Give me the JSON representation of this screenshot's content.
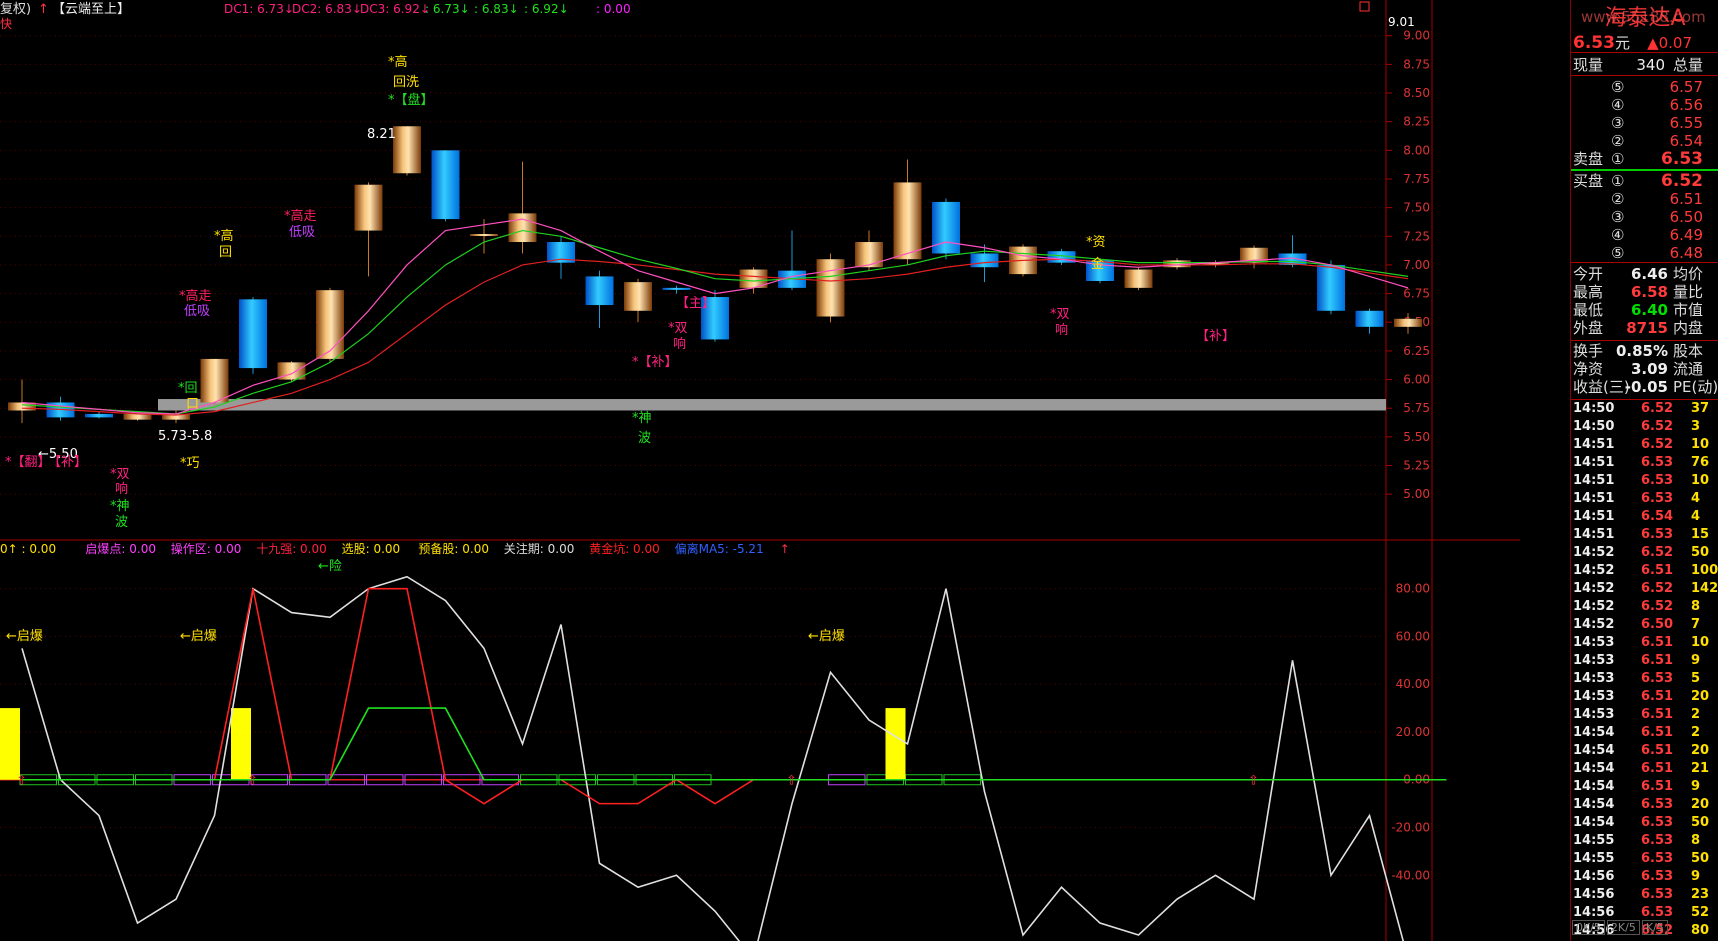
{
  "header": {
    "left_text": "复权)",
    "indicator_name": "【云端至上】",
    "dc1": "DC1: 6.73",
    "dc2": "DC2: 6.83",
    "dc3": "DC3: 6.92",
    "v1": ": 6.73",
    "v2": ": 6.83",
    "v3": ": 6.92",
    "v4": ": 0.00",
    "corner_mark": "快",
    "top_right_price": "9.01"
  },
  "price_axis": [
    "9.00",
    "8.75",
    "8.50",
    "8.25",
    "8.00",
    "7.75",
    "7.50",
    "7.25",
    "7.00",
    "6.75",
    "6.50",
    "6.25",
    "6.00",
    "5.75",
    "5.50",
    "5.25",
    "5.00"
  ],
  "osc_axis": [
    "80.00",
    "60.00",
    "40.00",
    "20.00",
    "0.00",
    "-20.00",
    "-40.00"
  ],
  "osc_header": {
    "i0": "0↑ : 0.00",
    "qibao": "启爆点: 0.00",
    "caozuo": "操作区: 0.00",
    "shijiu": "十九强: 0.00",
    "xuangu": "选股: 0.00",
    "yubei": "预备股: 0.00",
    "guanzhu": "关注期: 0.00",
    "huangjin": "黄金坑: 0.00",
    "pianli": "偏离MA5: -5.21"
  },
  "annotations": {
    "gao1": "*高",
    "huixi": "回洗",
    "pan": "*【盘】",
    "gao2": "*高",
    "hui2": "回",
    "gaozou1": "*高走",
    "dixi1": "低吸",
    "gaozou2": "*高走",
    "dixi2": "低吸",
    "price821": "8.21",
    "hui3": "*回",
    "kou": "口",
    "range": "5.73-5.8",
    "p550": "←5.50",
    "fan": "*【翻】",
    "bu1": "【补】",
    "shuang1": "*双",
    "xiang1": "响",
    "shen1": "*神",
    "bo1": "波",
    "qiao": "*巧",
    "shen2": "*神",
    "bo2": "波",
    "zhu1": "【主】",
    "shuang2": "*双",
    "xiang2": "响",
    "bu2": "*【补】",
    "zi": "*资",
    "jin": "金",
    "shuang3": "*双",
    "xiang3": "响",
    "bu3": "【补】",
    "qibao1": "←启爆",
    "qibao2": "←启爆",
    "qibao3": "←启爆",
    "xian": "←险"
  },
  "quote": {
    "name": "海泰达A",
    "watermark": "www.55188.com",
    "price": "6.53",
    "unit": "元",
    "change": "▲0.07",
    "xianliang_label": "现量",
    "xianliang": "340",
    "zongliang_label": "总量",
    "sell": [
      {
        "n": "⑤",
        "p": "6.57"
      },
      {
        "n": "④",
        "p": "6.56"
      },
      {
        "n": "③",
        "p": "6.55"
      },
      {
        "n": "②",
        "p": "6.54"
      },
      {
        "n": "①",
        "p": "6.53",
        "label": "卖盘"
      }
    ],
    "buy": [
      {
        "n": "①",
        "p": "6.52",
        "label": "买盘"
      },
      {
        "n": "②",
        "p": "6.51"
      },
      {
        "n": "③",
        "p": "6.50"
      },
      {
        "n": "④",
        "p": "6.49"
      },
      {
        "n": "⑤",
        "p": "6.48"
      }
    ],
    "stats": [
      {
        "l": "今开",
        "v": "6.46",
        "l2": "均价",
        "c": "white"
      },
      {
        "l": "最高",
        "v": "6.58",
        "l2": "量比",
        "c": "red"
      },
      {
        "l": "最低",
        "v": "6.40",
        "l2": "市值",
        "c": "green"
      },
      {
        "l": "外盘",
        "v": "8715",
        "l2": "内盘",
        "c": "red"
      }
    ],
    "stats2": [
      {
        "l": "换手",
        "v": "0.85%",
        "l2": "股本"
      },
      {
        "l": "净资",
        "v": "3.09",
        "l2": "流通"
      },
      {
        "l": "收益(三)",
        "v": "-0.05",
        "l2": "PE(动)"
      }
    ],
    "ticks": [
      {
        "t": "14:50",
        "p": "6.52",
        "v": "37",
        "c": "red"
      },
      {
        "t": "14:50",
        "p": "6.52",
        "v": "3",
        "c": "red"
      },
      {
        "t": "14:51",
        "p": "6.52",
        "v": "10",
        "c": "red"
      },
      {
        "t": "14:51",
        "p": "6.53",
        "v": "76",
        "c": "red"
      },
      {
        "t": "14:51",
        "p": "6.53",
        "v": "10",
        "c": "red"
      },
      {
        "t": "14:51",
        "p": "6.53",
        "v": "4",
        "c": "red"
      },
      {
        "t": "14:51",
        "p": "6.54",
        "v": "4",
        "c": "red"
      },
      {
        "t": "14:51",
        "p": "6.53",
        "v": "15",
        "c": "red"
      },
      {
        "t": "14:52",
        "p": "6.52",
        "v": "50",
        "c": "red"
      },
      {
        "t": "14:52",
        "p": "6.51",
        "v": "100",
        "c": "red"
      },
      {
        "t": "14:52",
        "p": "6.52",
        "v": "142",
        "c": "red"
      },
      {
        "t": "14:52",
        "p": "6.52",
        "v": "8",
        "c": "red"
      },
      {
        "t": "14:52",
        "p": "6.50",
        "v": "7",
        "c": "red"
      },
      {
        "t": "14:53",
        "p": "6.51",
        "v": "10",
        "c": "red"
      },
      {
        "t": "14:53",
        "p": "6.51",
        "v": "9",
        "c": "red"
      },
      {
        "t": "14:53",
        "p": "6.53",
        "v": "5",
        "c": "red"
      },
      {
        "t": "14:53",
        "p": "6.51",
        "v": "20",
        "c": "red"
      },
      {
        "t": "14:53",
        "p": "6.51",
        "v": "2",
        "c": "red"
      },
      {
        "t": "14:54",
        "p": "6.51",
        "v": "2",
        "c": "red"
      },
      {
        "t": "14:54",
        "p": "6.51",
        "v": "20",
        "c": "red"
      },
      {
        "t": "14:54",
        "p": "6.51",
        "v": "21",
        "c": "red"
      },
      {
        "t": "14:54",
        "p": "6.51",
        "v": "9",
        "c": "red"
      },
      {
        "t": "14:54",
        "p": "6.53",
        "v": "20",
        "c": "red"
      },
      {
        "t": "14:54",
        "p": "6.53",
        "v": "50",
        "c": "red"
      },
      {
        "t": "14:55",
        "p": "6.53",
        "v": "8",
        "c": "red"
      },
      {
        "t": "14:55",
        "p": "6.53",
        "v": "50",
        "c": "red"
      },
      {
        "t": "14:56",
        "p": "6.53",
        "v": "9",
        "c": "red"
      },
      {
        "t": "14:56",
        "p": "6.53",
        "v": "23",
        "c": "red"
      },
      {
        "t": "14:56",
        "p": "6.53",
        "v": "52",
        "c": "red"
      },
      {
        "t": "14:56",
        "p": "6.52",
        "v": "80",
        "c": "red"
      }
    ],
    "tabs": [
      "0K/5",
      "2K/5",
      "K/5"
    ]
  },
  "chart_data": {
    "type": "candlestick",
    "y_range": [
      4.6,
      9.05
    ],
    "support_band": [
      5.73,
      5.83
    ],
    "candles": [
      {
        "o": 5.73,
        "c": 5.8,
        "h": 6.0,
        "l": 5.62,
        "col": "gold"
      },
      {
        "o": 5.8,
        "c": 5.67,
        "h": 5.85,
        "l": 5.64,
        "col": "blue"
      },
      {
        "o": 5.7,
        "c": 5.67,
        "h": 5.72,
        "l": 5.66,
        "col": "blue"
      },
      {
        "o": 5.65,
        "c": 5.7,
        "h": 5.72,
        "l": 5.64,
        "col": "gold"
      },
      {
        "o": 5.65,
        "c": 5.7,
        "h": 5.73,
        "l": 5.62,
        "col": "gold"
      },
      {
        "o": 5.8,
        "c": 6.18,
        "h": 6.18,
        "l": 5.78,
        "col": "gold"
      },
      {
        "o": 6.7,
        "c": 6.1,
        "h": 6.72,
        "l": 6.05,
        "col": "blue"
      },
      {
        "o": 6.0,
        "c": 6.15,
        "h": 6.16,
        "l": 5.98,
        "col": "gold"
      },
      {
        "o": 6.18,
        "c": 6.78,
        "h": 6.8,
        "l": 6.15,
        "col": "gold"
      },
      {
        "o": 7.3,
        "c": 7.7,
        "h": 7.72,
        "l": 6.9,
        "col": "gold"
      },
      {
        "o": 7.8,
        "c": 8.21,
        "h": 8.21,
        "l": 7.78,
        "col": "gold"
      },
      {
        "o": 8.0,
        "c": 7.4,
        "h": 8.0,
        "l": 7.38,
        "col": "blue"
      },
      {
        "o": 7.27,
        "c": 7.26,
        "h": 7.4,
        "l": 7.1,
        "col": "gold"
      },
      {
        "o": 7.2,
        "c": 7.45,
        "h": 7.9,
        "l": 7.1,
        "col": "gold"
      },
      {
        "o": 7.2,
        "c": 7.02,
        "h": 7.25,
        "l": 6.88,
        "col": "blue"
      },
      {
        "o": 6.9,
        "c": 6.65,
        "h": 6.95,
        "l": 6.45,
        "col": "blue"
      },
      {
        "o": 6.6,
        "c": 6.85,
        "h": 6.88,
        "l": 6.5,
        "col": "gold"
      },
      {
        "o": 6.8,
        "c": 6.79,
        "h": 6.82,
        "l": 6.75,
        "col": "blue"
      },
      {
        "o": 6.72,
        "c": 6.35,
        "h": 6.78,
        "l": 6.33,
        "col": "blue"
      },
      {
        "o": 6.8,
        "c": 6.96,
        "h": 6.98,
        "l": 6.75,
        "col": "gold"
      },
      {
        "o": 6.95,
        "c": 6.8,
        "h": 7.3,
        "l": 6.78,
        "col": "blue"
      },
      {
        "o": 6.55,
        "c": 7.05,
        "h": 7.1,
        "l": 6.5,
        "col": "gold"
      },
      {
        "o": 6.98,
        "c": 7.2,
        "h": 7.3,
        "l": 6.95,
        "col": "gold"
      },
      {
        "o": 7.05,
        "c": 7.72,
        "h": 7.92,
        "l": 7.0,
        "col": "gold"
      },
      {
        "o": 7.55,
        "c": 7.1,
        "h": 7.58,
        "l": 7.05,
        "col": "blue"
      },
      {
        "o": 7.1,
        "c": 6.98,
        "h": 7.18,
        "l": 6.85,
        "col": "blue"
      },
      {
        "o": 6.92,
        "c": 7.16,
        "h": 7.18,
        "l": 6.9,
        "col": "gold"
      },
      {
        "o": 7.12,
        "c": 7.02,
        "h": 7.14,
        "l": 7.0,
        "col": "blue"
      },
      {
        "o": 7.04,
        "c": 6.86,
        "h": 7.06,
        "l": 6.84,
        "col": "blue"
      },
      {
        "o": 6.8,
        "c": 6.96,
        "h": 6.98,
        "l": 6.78,
        "col": "gold"
      },
      {
        "o": 6.98,
        "c": 7.04,
        "h": 7.06,
        "l": 6.96,
        "col": "gold"
      },
      {
        "o": 7.0,
        "c": 7.02,
        "h": 7.04,
        "l": 6.98,
        "col": "gold"
      },
      {
        "o": 7.02,
        "c": 7.15,
        "h": 7.17,
        "l": 6.97,
        "col": "gold"
      },
      {
        "o": 7.1,
        "c": 7.0,
        "h": 7.26,
        "l": 6.98,
        "col": "blue"
      },
      {
        "o": 7.0,
        "c": 6.6,
        "h": 7.04,
        "l": 6.57,
        "col": "blue"
      },
      {
        "o": 6.6,
        "c": 6.46,
        "h": 6.62,
        "l": 6.4,
        "col": "blue"
      },
      {
        "o": 6.46,
        "c": 6.53,
        "h": 6.58,
        "l": 6.4,
        "col": "gold"
      }
    ],
    "ma_slow": [
      5.75,
      5.74,
      5.72,
      5.7,
      5.69,
      5.72,
      5.8,
      5.88,
      6.0,
      6.15,
      6.4,
      6.65,
      6.85,
      7.0,
      7.05,
      7.03,
      7.0,
      6.96,
      6.92,
      6.9,
      6.88,
      6.86,
      6.88,
      6.92,
      6.98,
      7.02,
      7.04,
      7.05,
      7.03,
      7.0,
      7.0,
      7.0,
      7.01,
      7.01,
      6.98,
      6.93,
      6.88
    ],
    "ma_mid": [
      5.78,
      5.76,
      5.74,
      5.72,
      5.7,
      5.76,
      5.88,
      5.98,
      6.15,
      6.4,
      6.72,
      7.0,
      7.2,
      7.3,
      7.25,
      7.15,
      7.05,
      6.97,
      6.88,
      6.86,
      6.88,
      6.9,
      6.95,
      7.0,
      7.08,
      7.12,
      7.1,
      7.08,
      7.05,
      7.02,
      7.02,
      7.02,
      7.03,
      7.03,
      7.0,
      6.95,
      6.9
    ],
    "ma_fast": [
      5.8,
      5.77,
      5.74,
      5.71,
      5.7,
      5.8,
      5.95,
      6.05,
      6.25,
      6.6,
      7.0,
      7.3,
      7.35,
      7.4,
      7.3,
      7.12,
      6.95,
      6.85,
      6.75,
      6.8,
      6.9,
      6.95,
      7.0,
      7.1,
      7.2,
      7.15,
      7.08,
      7.05,
      7.0,
      6.98,
      7.0,
      7.02,
      7.04,
      7.06,
      7.0,
      6.9,
      6.8
    ],
    "oscillator": {
      "range": [
        -65,
        92
      ],
      "white": [
        55,
        0,
        -15,
        -60,
        -50,
        -15,
        80,
        70,
        68,
        80,
        85,
        75,
        55,
        15,
        65,
        -35,
        -45,
        -40,
        -55,
        -75,
        -10,
        45,
        25,
        15,
        80,
        -5,
        -65,
        -45,
        -60,
        -65,
        -50,
        -40,
        -50,
        50,
        -40,
        -15,
        -75,
        -70
      ],
      "red": [
        0,
        0,
        0,
        0,
        0,
        0,
        80,
        0,
        0,
        80,
        80,
        0,
        -10,
        0,
        0,
        -10,
        -10,
        0,
        -10,
        0,
        0,
        0,
        0,
        0,
        0,
        0,
        0,
        0,
        0,
        0,
        0,
        0,
        0,
        0,
        0,
        0,
        0,
        0
      ],
      "green": [
        0,
        0,
        0,
        0,
        0,
        0,
        0,
        0,
        0,
        30,
        30,
        30,
        0,
        0,
        0,
        0,
        0,
        0,
        0,
        0,
        0,
        0,
        0,
        0,
        0,
        0,
        0,
        0,
        0,
        0,
        0,
        0,
        0,
        0,
        0,
        0,
        0,
        0
      ],
      "yellow_bars": [
        0,
        6,
        23
      ],
      "yellow_height": 30,
      "arrow_positions": [
        0,
        6,
        20,
        32
      ]
    }
  }
}
